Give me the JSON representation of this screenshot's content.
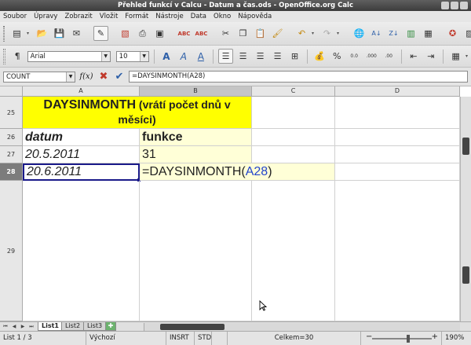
{
  "window": {
    "title": "Přehled funkcí v Calcu - Datum a čas.ods - OpenOffice.org Calc"
  },
  "menu": [
    "Soubor",
    "Úpravy",
    "Zobrazit",
    "Vložit",
    "Formát",
    "Nástroje",
    "Data",
    "Okno",
    "Nápověda"
  ],
  "toolbar": {
    "icons_row1": [
      "new-document-icon",
      "open-icon",
      "save-icon",
      "email-icon",
      "edit-file-icon",
      "export-pdf-icon",
      "print-icon",
      "print-preview-icon",
      "spellcheck-icon",
      "autospellcheck-icon",
      "cut-icon",
      "copy-icon",
      "paste-icon",
      "clone-format-icon",
      "undo-icon",
      "redo-icon",
      "hyperlink-icon",
      "sort-ascending-icon",
      "sort-descending-icon",
      "chart-icon",
      "pivot-icon",
      "navigator-icon"
    ],
    "font_name": "Arial",
    "font_size": "10"
  },
  "formula_bar": {
    "name_box": "COUNT",
    "fx_label": "f(x)",
    "content": "=DAYSINMONTH(A28)"
  },
  "columns": [
    "A",
    "B",
    "C",
    "D"
  ],
  "rows": [
    {
      "num": "25"
    },
    {
      "num": "26"
    },
    {
      "num": "27"
    },
    {
      "num": "28"
    },
    {
      "num": "29"
    }
  ],
  "cells": {
    "A25_main": "DAYSINMONTH",
    "A25_sub": " (vrátí počet dnů v měsíci)",
    "A26": "datum",
    "B26": "funkce",
    "A27": "20.5.2011",
    "B27": "31",
    "A28": "20.6.2011",
    "B28_prefix": "=DAYSINMONTH(",
    "B28_ref": "A28",
    "B28_suffix": ")"
  },
  "sheets": [
    "List1",
    "List2",
    "List3"
  ],
  "status": {
    "sheet": "List 1 / 3",
    "style": "Výchozí",
    "mode": "INSRT",
    "selection": "STD",
    "sum": "Celkem=30",
    "zoom": "190%"
  },
  "colors": {
    "header_fill": "#ffff00",
    "edit_fill": "#ffffd7",
    "reference": "#2244cc"
  }
}
